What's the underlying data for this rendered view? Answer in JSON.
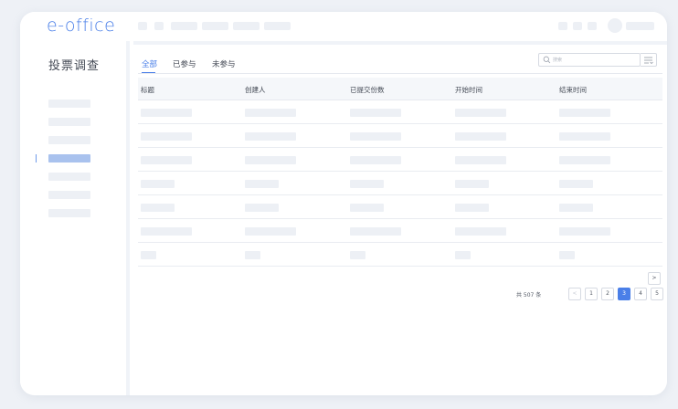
{
  "app": {
    "logo": "e-office",
    "logo_color": "#4a7fe8"
  },
  "sidebar": {
    "title": "投票调查",
    "active_index": 3,
    "item_count": 7
  },
  "tabs": [
    {
      "label": "全部",
      "active": true
    },
    {
      "label": "已参与",
      "active": false
    },
    {
      "label": "未参与",
      "active": false
    }
  ],
  "search": {
    "placeholder": "搜索"
  },
  "table": {
    "columns": [
      "标题",
      "创建人",
      "已提交份数",
      "开始时间",
      "结束时间"
    ],
    "row_count": 7
  },
  "pagination": {
    "total_label": "共 507 条",
    "prev": "<",
    "next": ">",
    "pages": [
      "1",
      "2",
      "3",
      "4",
      "5"
    ],
    "current": "3"
  },
  "colors": {
    "accent": "#4a7fe8",
    "placeholder": "#edf0f5",
    "active_sidebar": "#a9c2ee"
  },
  "icons": [
    "search-icon",
    "filter-icon",
    "chevron-left-icon",
    "chevron-right-icon"
  ]
}
